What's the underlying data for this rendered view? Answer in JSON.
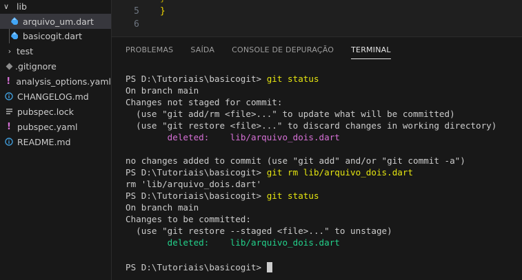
{
  "sidebar": {
    "items": [
      {
        "label": "lib",
        "type": "folder-open"
      },
      {
        "label": "arquivo_um.dart",
        "type": "dart"
      },
      {
        "label": "basicogit.dart",
        "type": "dart"
      },
      {
        "label": "test",
        "type": "folder-closed"
      },
      {
        "label": ".gitignore",
        "type": "git"
      },
      {
        "label": "analysis_options.yaml",
        "type": "yaml"
      },
      {
        "label": "CHANGELOG.md",
        "type": "info"
      },
      {
        "label": "pubspec.lock",
        "type": "lock"
      },
      {
        "label": "pubspec.yaml",
        "type": "yaml"
      },
      {
        "label": "README.md",
        "type": "info"
      }
    ]
  },
  "editor": {
    "lines": [
      {
        "number": "5",
        "code": "}"
      },
      {
        "number": "6",
        "code": ""
      }
    ]
  },
  "panel": {
    "tabs": [
      "PROBLEMAS",
      "SAÍDA",
      "CONSOLE DE DEPURAÇÃO",
      "TERMINAL"
    ],
    "active_tab": "TERMINAL"
  },
  "terminal": {
    "prompt": "PS D:\\Tutoriais\\basicogit> ",
    "cmd1": "git status",
    "l_branch": "On branch main",
    "l_not_staged": "Changes not staged for commit:",
    "l_hint_add": "  (use \"git add/rm <file>...\" to update what will be committed)",
    "l_hint_restore": "  (use \"git restore <file>...\" to discard changes in working directory)",
    "deleted_label": "        deleted:    ",
    "deleted_file": "lib/arquivo_dois.dart",
    "l_no_changes": "no changes added to commit (use \"git add\" and/or \"git commit -a\")",
    "cmd2": "git rm lib/arquivo_dois.dart",
    "l_rm": "rm 'lib/arquivo_dois.dart'",
    "cmd3": "git status",
    "l_to_be_committed": "Changes to be committed:",
    "l_hint_unstage": "  (use \"git restore --staged <file>...\" to unstage)"
  },
  "colors": {
    "prompt_cmd": "#e5e510",
    "deleted_unstaged": "#d670d6",
    "deleted_staged": "#23d18b",
    "dart_icon": "#42a5f5",
    "yaml_icon": "#d670d6",
    "info_icon": "#3f9ad6",
    "git_icon": "#8e8e8e"
  }
}
